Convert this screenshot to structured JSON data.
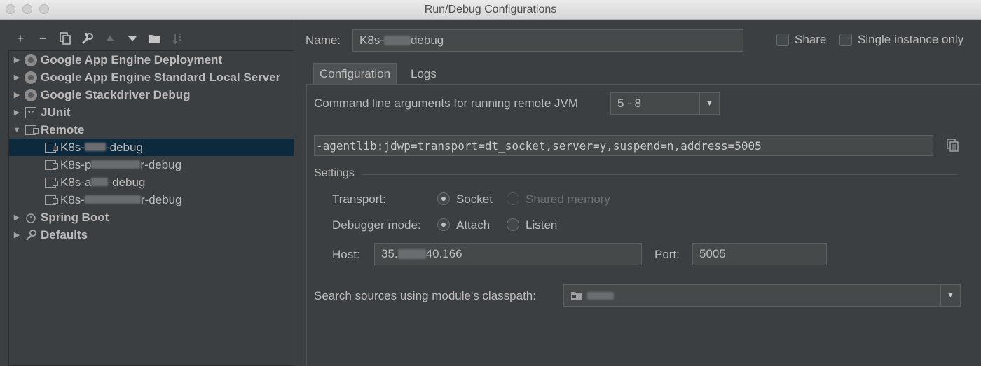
{
  "window": {
    "title": "Run/Debug Configurations"
  },
  "toolbar": {
    "add": "+",
    "remove": "−",
    "copy": "⧉",
    "edit": "🔧",
    "up": "▲",
    "down": "▼",
    "folder": "▬",
    "sort": "↓"
  },
  "tree": {
    "items": [
      {
        "label": "Google App Engine Deployment",
        "icon": "app-engine-icon"
      },
      {
        "label": "Google App Engine Standard Local Server",
        "icon": "app-engine-icon"
      },
      {
        "label": "Google Stackdriver Debug",
        "icon": "stackdriver-icon"
      },
      {
        "label": "JUnit",
        "icon": "junit-icon"
      },
      {
        "label": "Remote",
        "icon": "remote-icon"
      },
      {
        "label": "Spring Boot",
        "icon": "spring-boot-icon"
      },
      {
        "label": "Defaults",
        "icon": "defaults-icon"
      }
    ],
    "remote_children": [
      {
        "prefix": "K8s-",
        "suffix": "-debug"
      },
      {
        "prefix": "K8s-p",
        "suffix": "r-debug"
      },
      {
        "prefix": "K8s-a",
        "suffix": "-debug"
      },
      {
        "prefix": "K8s-",
        "suffix": "r-debug"
      }
    ]
  },
  "header": {
    "name_label": "Name:",
    "name_prefix": "K8s-",
    "name_suffix": "debug",
    "share_label": "Share",
    "single_instance_label": "Single instance only"
  },
  "tabs": [
    {
      "label": "Configuration",
      "active": true
    },
    {
      "label": "Logs",
      "active": false
    }
  ],
  "config": {
    "cmd_label": "Command line arguments for running remote JVM",
    "jvm_version": "5 - 8",
    "cmd_value": "-agentlib:jdwp=transport=dt_socket,server=y,suspend=n,address=5005",
    "settings_label": "Settings",
    "transport_label": "Transport:",
    "transport_socket": "Socket",
    "transport_shared": "Shared memory",
    "debugger_label": "Debugger mode:",
    "debugger_attach": "Attach",
    "debugger_listen": "Listen",
    "host_label": "Host:",
    "host_prefix": "35.",
    "host_suffix": "40.166",
    "port_label": "Port:",
    "port_value": "5005",
    "classpath_label": "Search sources using module's classpath:"
  }
}
